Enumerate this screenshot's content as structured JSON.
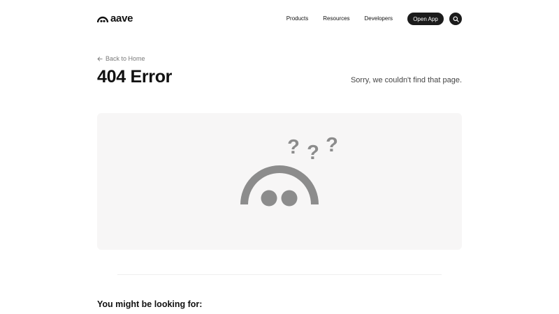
{
  "header": {
    "logo_text": "aave",
    "nav": {
      "products": "Products",
      "resources": "Resources",
      "developers": "Developers"
    },
    "open_app_label": "Open App",
    "search_icon": "search-icon"
  },
  "hero": {
    "back_arrow_icon": "arrow-left-icon",
    "back_link": "Back to Home",
    "title": "404 Error",
    "subtitle": "Sorry, we couldn't find that page."
  },
  "illustration": {
    "marks": [
      "?",
      "?",
      "?"
    ],
    "ghost_color": "#8c8c8c",
    "card_background": "#f7f6f6"
  },
  "suggestions": {
    "heading": "You might be looking for:"
  },
  "colors": {
    "primary_button": "#1b1b1b",
    "text": "#111111",
    "muted_text": "#7a7a7a"
  }
}
